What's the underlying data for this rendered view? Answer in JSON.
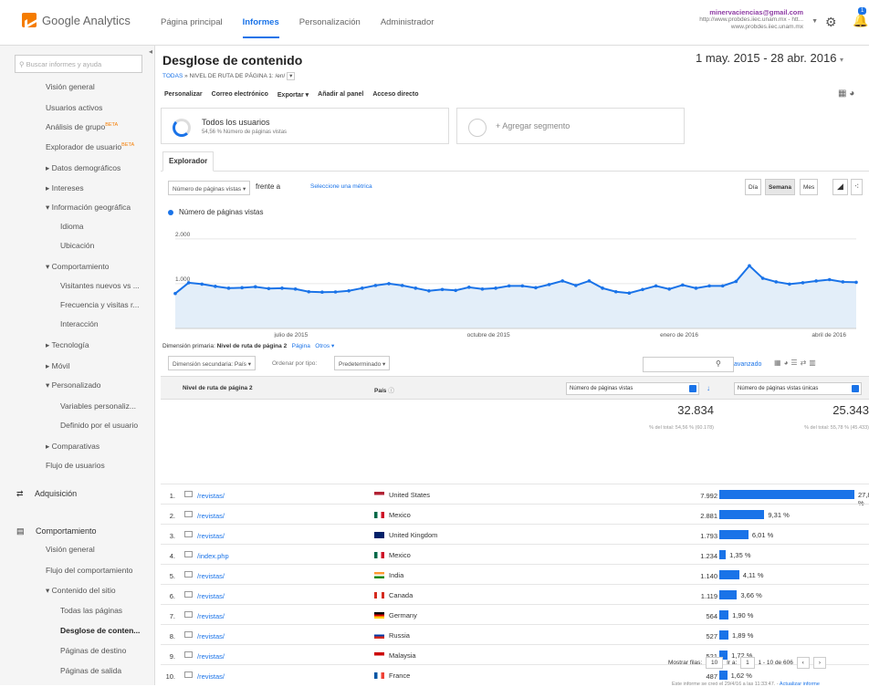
{
  "app": {
    "logo_text": "Google Analytics"
  },
  "nav": {
    "items": [
      "Página principal",
      "Informes",
      "Personalización",
      "Administrador"
    ],
    "active": "Informes"
  },
  "account": {
    "email": "minervaciencias@gmail.com",
    "property": "http://www.probdes.iiec.unam.mx - htt...",
    "view": "www.probdes.iiec.unam.mx",
    "notifications": "1"
  },
  "sidebar": {
    "search_placeholder": "Buscar informes y ayuda",
    "items": [
      {
        "label": "Visión general",
        "beta": ""
      },
      {
        "label": "Usuarios activos",
        "beta": ""
      },
      {
        "label": "Análisis de grupo",
        "beta": "BETA"
      },
      {
        "label": "Explorador de usuario",
        "beta": "BETA"
      },
      {
        "label": "▸ Datos demográficos",
        "beta": ""
      },
      {
        "label": "▸ Intereses",
        "beta": ""
      },
      {
        "label": "▾ Información geográfica",
        "beta": ""
      },
      {
        "label": "Idioma",
        "beta": ""
      },
      {
        "label": "Ubicación",
        "beta": ""
      },
      {
        "label": "▾ Comportamiento",
        "beta": ""
      },
      {
        "label": "Visitantes nuevos vs ...",
        "beta": ""
      },
      {
        "label": "Frecuencia y visitas r...",
        "beta": ""
      },
      {
        "label": "Interacción",
        "beta": ""
      },
      {
        "label": "▸ Tecnología",
        "beta": ""
      },
      {
        "label": "▸ Móvil",
        "beta": ""
      },
      {
        "label": "▾ Personalizado",
        "beta": ""
      },
      {
        "label": "Variables personaliz...",
        "beta": ""
      },
      {
        "label": "Definido por el usuario",
        "beta": ""
      },
      {
        "label": "▸ Comparativas",
        "beta": ""
      },
      {
        "label": "Flujo de usuarios",
        "beta": ""
      }
    ],
    "sections": [
      {
        "label": "Adquisición",
        "icon": "acquisition-icon"
      },
      {
        "label": "Comportamiento",
        "icon": "behavior-icon"
      }
    ],
    "behavior_items": [
      {
        "label": "Visión general",
        "bold": false
      },
      {
        "label": "Flujo del comportamiento",
        "bold": false
      },
      {
        "label": "▾ Contenido del sitio",
        "bold": false
      },
      {
        "label": "Todas las páginas",
        "bold": false
      },
      {
        "label": "Desglose de conten...",
        "bold": true
      },
      {
        "label": "Páginas de destino",
        "bold": false
      },
      {
        "label": "Páginas de salida",
        "bold": false
      },
      {
        "label": "▸ Velocidad del sitio",
        "bold": false
      }
    ]
  },
  "report": {
    "title": "Desglose de contenido",
    "breadcrumb_root": "TODAS",
    "breadcrumb_sep": "»",
    "breadcrumb_rest": "NIVEL DE RUTA DE PÁGINA 1: /en/",
    "date_range": "1 may. 2015 - 28 abr. 2016",
    "toolbar": [
      "Personalizar",
      "Correo electrónico",
      "Exportar ▾",
      "Añadir al panel",
      "Acceso directo"
    ]
  },
  "segments": {
    "seg1_title": "Todos los usuarios",
    "seg1_sub": "54,56 % Número de páginas vistas",
    "seg2_title": "+ Agregar segmento"
  },
  "explorer": {
    "tab": "Explorador",
    "metric_select": "Número de páginas vistas",
    "versus": "frente a",
    "select_metric": "Seleccione una métrica",
    "granularity": [
      "Día",
      "Semana",
      "Mes"
    ],
    "active_granularity": "Semana",
    "legend": "Número de páginas vistas"
  },
  "chart_data": {
    "type": "line",
    "series": [
      {
        "name": "Número de páginas vistas",
        "values": [
          780,
          1020,
          990,
          940,
          900,
          910,
          930,
          890,
          900,
          880,
          820,
          810,
          815,
          840,
          900,
          960,
          1000,
          960,
          900,
          840,
          870,
          850,
          920,
          880,
          900,
          950,
          950,
          910,
          980,
          1060,
          960,
          1060,
          900,
          820,
          790,
          870,
          950,
          880,
          970,
          900,
          950,
          950,
          1050,
          1400,
          1120,
          1040,
          990,
          1020,
          1060,
          1090,
          1040,
          1030
        ]
      }
    ],
    "yticks": [
      "2.000",
      "1.000"
    ],
    "ylim": [
      0,
      2200
    ],
    "xlabels": [
      "julio de 2015",
      "octubre de 2015",
      "enero de 2016",
      "abril de 2016"
    ],
    "grid": true,
    "color": "#1a73e8"
  },
  "dimension": {
    "label": "Dimensión primaria:",
    "active": "Nivel de ruta de página 2",
    "links": [
      "Página",
      "Otros ▾"
    ]
  },
  "table_controls": {
    "secondary": "Dimensión secundaria: País ▾",
    "sort_label": "Ordenar por tipo:",
    "sort_value": "Predeterminado ▾",
    "advanced": "avanzado"
  },
  "table": {
    "headers": {
      "dim": "Nivel de ruta de página 2",
      "country": "País",
      "metric1": "Número de páginas vistas",
      "metric2": "Número de páginas vistas únicas"
    },
    "total1": "32.834",
    "total1_sub": "% del total: 54,56 % (60.178)",
    "total2": "25.343",
    "total2_sub": "% del total: 55,78 % (45.433)",
    "rows": [
      {
        "n": "1.",
        "page": "/revistas/",
        "country": "United States",
        "value": "7.992",
        "pct": "27,89 %",
        "share": 27.89,
        "flag": "us"
      },
      {
        "n": "2.",
        "page": "/revistas/",
        "country": "Mexico",
        "value": "2.881",
        "pct": "9,31 %",
        "share": 9.31,
        "flag": "mx"
      },
      {
        "n": "3.",
        "page": "/revistas/",
        "country": "United Kingdom",
        "value": "1.793",
        "pct": "6,01 %",
        "share": 6.01,
        "flag": "uk"
      },
      {
        "n": "4.",
        "page": "/index.php",
        "country": "Mexico",
        "value": "1.234",
        "pct": "1,35 %",
        "share": 1.35,
        "flag": "mx"
      },
      {
        "n": "5.",
        "page": "/revistas/",
        "country": "India",
        "value": "1.140",
        "pct": "4,11 %",
        "share": 4.11,
        "flag": "in"
      },
      {
        "n": "6.",
        "page": "/revistas/",
        "country": "Canada",
        "value": "1.119",
        "pct": "3,66 %",
        "share": 3.66,
        "flag": "ca"
      },
      {
        "n": "7.",
        "page": "/revistas/",
        "country": "Germany",
        "value": "564",
        "pct": "1,90 %",
        "share": 1.9,
        "flag": "de"
      },
      {
        "n": "8.",
        "page": "/revistas/",
        "country": "Russia",
        "value": "527",
        "pct": "1,89 %",
        "share": 1.89,
        "flag": "ru"
      },
      {
        "n": "9.",
        "page": "/revistas/",
        "country": "Malaysia",
        "value": "521",
        "pct": "1,72 %",
        "share": 1.72,
        "flag": "my"
      },
      {
        "n": "10.",
        "page": "/revistas/",
        "country": "France",
        "value": "487",
        "pct": "1,62 %",
        "share": 1.62,
        "flag": "fr"
      }
    ]
  },
  "pager": {
    "show_rows": "Mostrar filas:",
    "rows_value": "10",
    "goto": "Ir a:",
    "goto_value": "1",
    "range": "1 - 10 de 606"
  },
  "footer": {
    "text": "Este informe se creó el 29/4/16 a las 11:33:47. -",
    "link": "Actualizar informe"
  }
}
